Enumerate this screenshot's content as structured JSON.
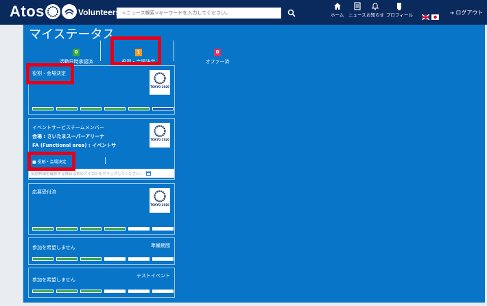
{
  "header": {
    "brand": "Atos",
    "volunteers": "Volunteers",
    "search_placeholder": "<ニュース検索>キーワードを入力してください。",
    "nav": [
      {
        "label": "ホーム",
        "icon": "home-icon"
      },
      {
        "label": "ニュース",
        "icon": "news-icon"
      },
      {
        "label": "お知らせ",
        "icon": "bell-icon"
      },
      {
        "label": "プロフィール",
        "icon": "profile-icon"
      }
    ],
    "logout": "ログアウト"
  },
  "page": {
    "title": "マイステータス",
    "stats": [
      {
        "count": "0",
        "label": "活動日時承認済",
        "color": "#3aaa35"
      },
      {
        "count": "1",
        "label": "役割・会場決定",
        "color": "#f29a1f"
      },
      {
        "count": "0",
        "label": "オファー済",
        "color": "#e0315b"
      }
    ]
  },
  "cards": [
    {
      "title": "役割・会場決定",
      "progress": [
        "green",
        "green",
        "green",
        "green",
        "green",
        "blue"
      ]
    },
    {
      "line1": "イベントサービスチームメンバー",
      "line2": "会場 : さいたまスーパーアリーナ",
      "line3": "FA (Functional area) : イベントサ",
      "status": "役割・会場決定",
      "note": "役割詳細を確認する場合は右のアイコンをクリックしてください。"
    },
    {
      "title": "応募受付済",
      "progress": [
        "green",
        "green",
        "green",
        "green",
        "white",
        "white"
      ]
    },
    {
      "title": "参加を希望しません",
      "right": "準備期間",
      "progress": [
        "green",
        "green",
        "green",
        "white",
        "white",
        "white"
      ]
    },
    {
      "title": "参加を希望しません",
      "right": "テストイベント",
      "progress": [
        "green",
        "green",
        "green",
        "white",
        "white",
        "white"
      ]
    }
  ],
  "logos": {
    "olympic": "TOKYO 2020",
    "paralympic": "TOKYO 2020"
  }
}
